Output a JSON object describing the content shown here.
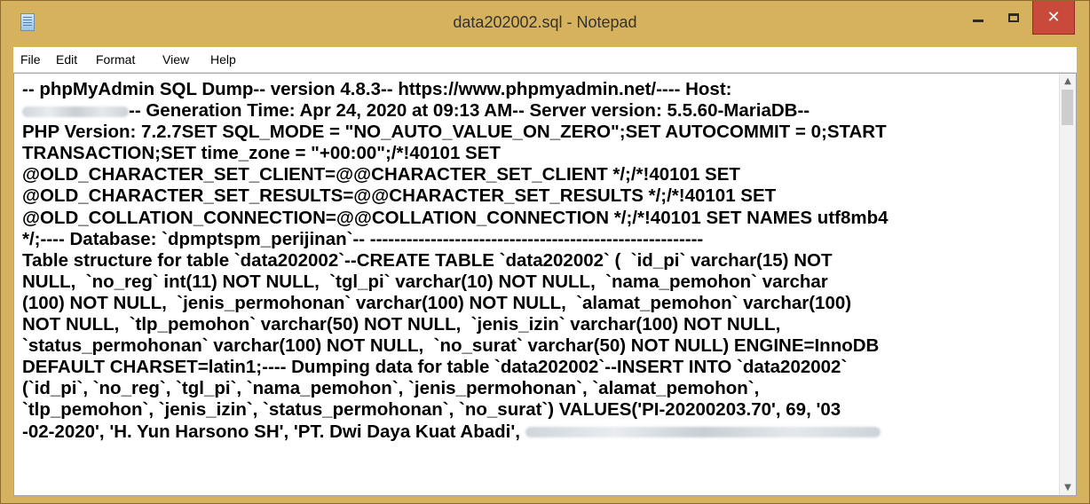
{
  "window": {
    "title": "data202002.sql - Notepad",
    "controls": {
      "minimize": "–",
      "maximize": "□",
      "close": "✕"
    },
    "accent_frame_color": "#d6b25e",
    "close_button_color": "#c94a3b"
  },
  "menu": [
    "File",
    "Edit",
    "Format",
    "View",
    "Help"
  ],
  "editor": {
    "line1": "-- phpMyAdmin SQL Dump-- version 4.8.3-- https://www.phpmyadmin.net/---- Host:",
    "line2": "-- Generation Time: Apr 24, 2020 at 09:13 AM-- Server version: 5.5.60-MariaDB--",
    "line3": "PHP Version: 7.2.7SET SQL_MODE = \"NO_AUTO_VALUE_ON_ZERO\";SET AUTOCOMMIT = 0;START",
    "line4": "TRANSACTION;SET time_zone = \"+00:00\";/*!40101 SET",
    "line5": "@OLD_CHARACTER_SET_CLIENT=@@CHARACTER_SET_CLIENT */;/*!40101 SET",
    "line6": "@OLD_CHARACTER_SET_RESULTS=@@CHARACTER_SET_RESULTS */;/*!40101 SET",
    "line7": "@OLD_COLLATION_CONNECTION=@@COLLATION_CONNECTION */;/*!40101 SET NAMES utf8mb4",
    "line8": "*/;---- Database: `dpmptspm_perijinan`-- -------------------------------------------------------",
    "line9": "Table structure for table `data202002`--CREATE TABLE `data202002` (  `id_pi` varchar(15) NOT",
    "line10": "NULL,  `no_reg` int(11) NOT NULL,  `tgl_pi` varchar(10) NOT NULL,  `nama_pemohon` varchar",
    "line11": "(100) NOT NULL,  `jenis_permohonan` varchar(100) NOT NULL,  `alamat_pemohon` varchar(100)",
    "line12": "NOT NULL,  `tlp_pemohon` varchar(50) NOT NULL,  `jenis_izin` varchar(100) NOT NULL,",
    "line13": "`status_permohonan` varchar(100) NOT NULL,  `no_surat` varchar(50) NOT NULL) ENGINE=InnoDB",
    "line14": "DEFAULT CHARSET=latin1;---- Dumping data for table `data202002`--INSERT INTO `data202002`",
    "line15": "(`id_pi`, `no_reg`, `tgl_pi`, `nama_pemohon`, `jenis_permohonan`, `alamat_pemohon`,",
    "line16": "`tlp_pemohon`, `jenis_izin`, `status_permohonan`, `no_surat`) VALUES('PI-20200203.70', 69, '03",
    "line17": "-02-2020', 'H. Yun Harsono SH', 'PT. Dwi Daya Kuat Abadi',"
  },
  "scrollbar": {
    "up": "▲",
    "down": "▼"
  }
}
